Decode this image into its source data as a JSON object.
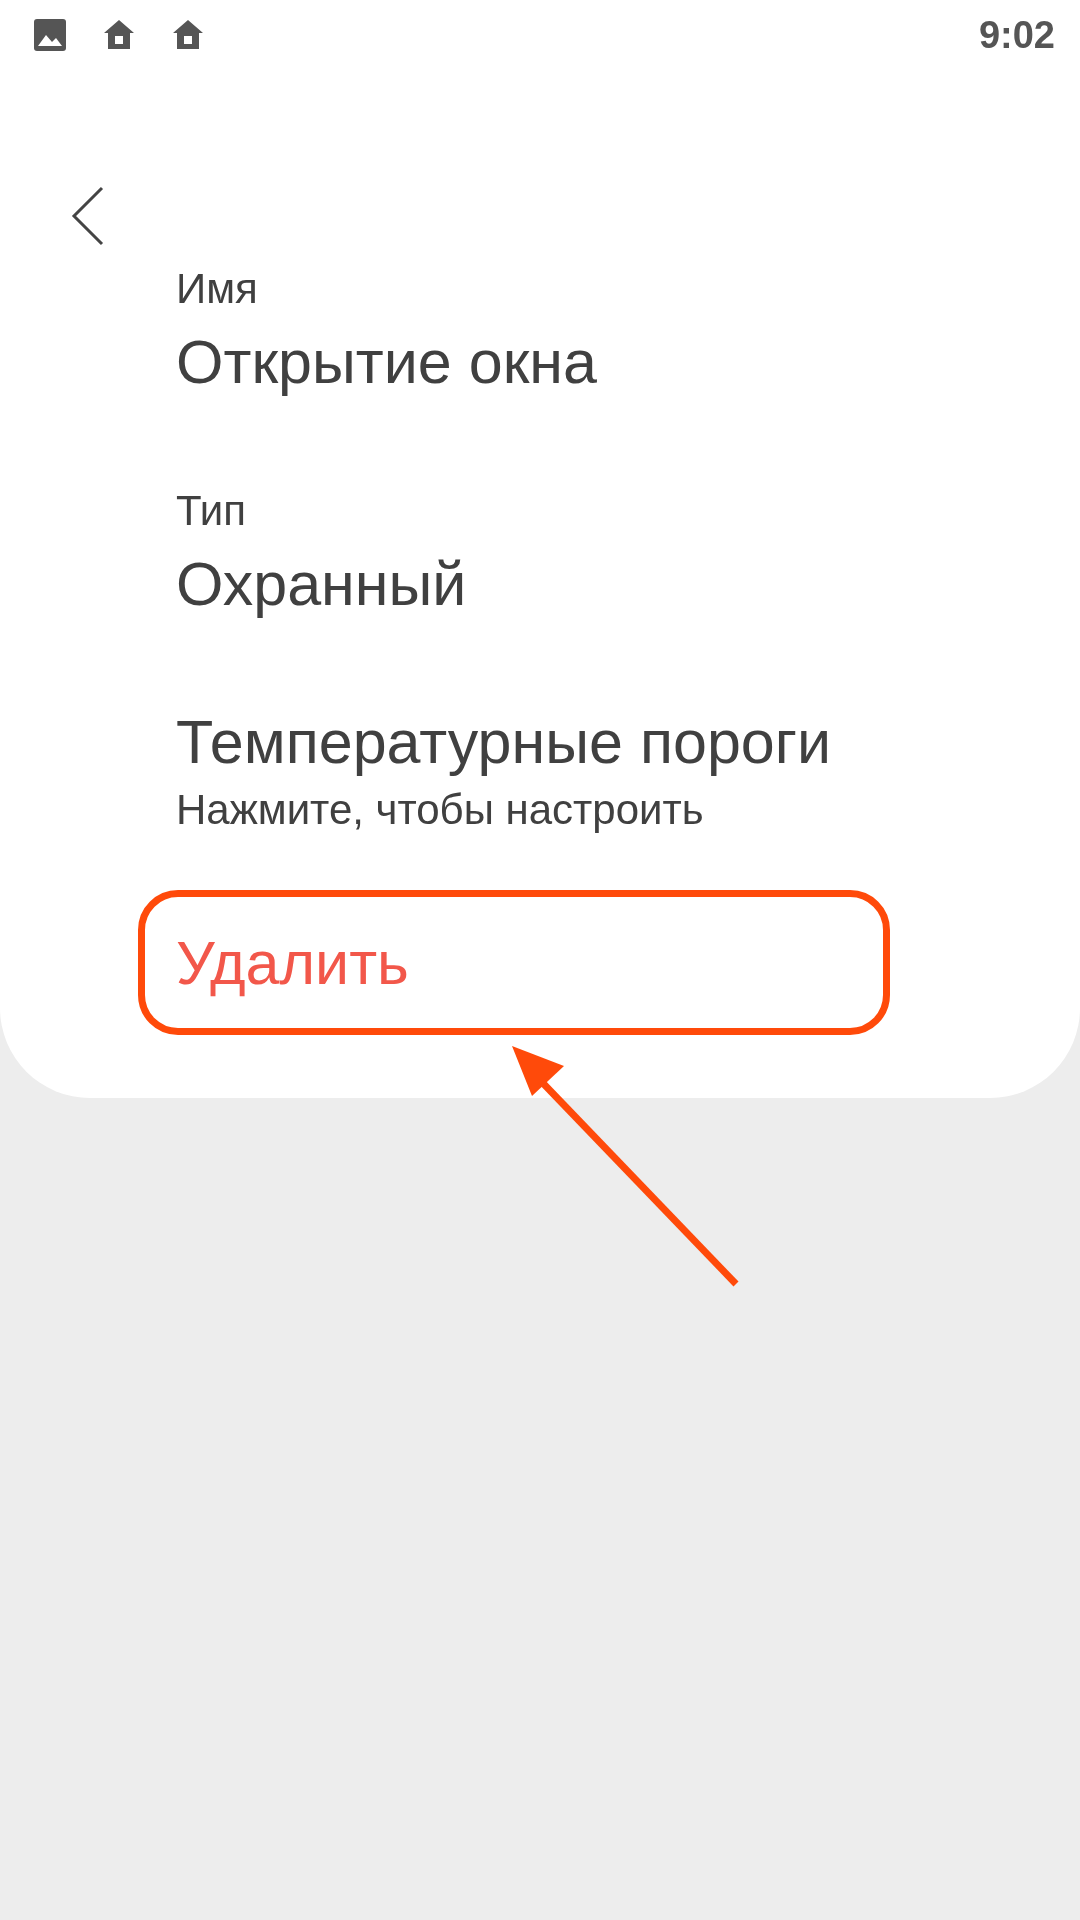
{
  "status_bar": {
    "icons": [
      {
        "kind": "image"
      },
      {
        "kind": "home"
      },
      {
        "kind": "home"
      }
    ],
    "time": "9:02"
  },
  "fields": [
    {
      "kind": "labeled",
      "label": "Имя",
      "value": "Открытие окна"
    },
    {
      "kind": "labeled",
      "label": "Тип",
      "value": "Охранный"
    },
    {
      "kind": "action",
      "title": "Температурные пороги",
      "subtitle": "Нажмите, чтобы настроить"
    }
  ],
  "delete_button": {
    "label": "Удалить"
  },
  "annotations": {
    "highlight_frame": true,
    "arrow": true
  }
}
